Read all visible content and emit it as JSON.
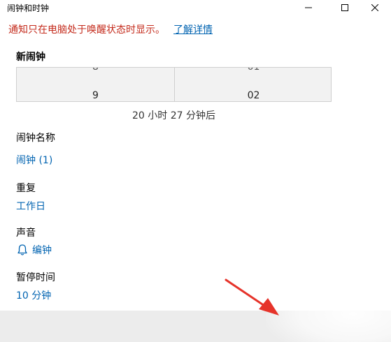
{
  "window": {
    "title": "闹钟和时钟"
  },
  "notice": {
    "text": "通知只在电脑处于唤醒状态时显示。",
    "link": "了解详情"
  },
  "new_alarm": {
    "heading": "新闹钟"
  },
  "time_picker": {
    "hour_prev": "8",
    "hour": "9",
    "minute_prev": "01",
    "minute": "02"
  },
  "countdown": "20 小时 27 分钟后",
  "alarm_name": {
    "label": "闹钟名称",
    "value": "闹钟 (1)"
  },
  "repeat": {
    "label": "重复",
    "value": "工作日"
  },
  "sound": {
    "label": "声音",
    "value": "编钟",
    "icon": "bell-icon"
  },
  "snooze": {
    "label": "暂停时间",
    "value": "10 分钟"
  },
  "colors": {
    "accent": "#0063b1",
    "warning": "#c42b1c",
    "arrow": "#e6332a"
  }
}
